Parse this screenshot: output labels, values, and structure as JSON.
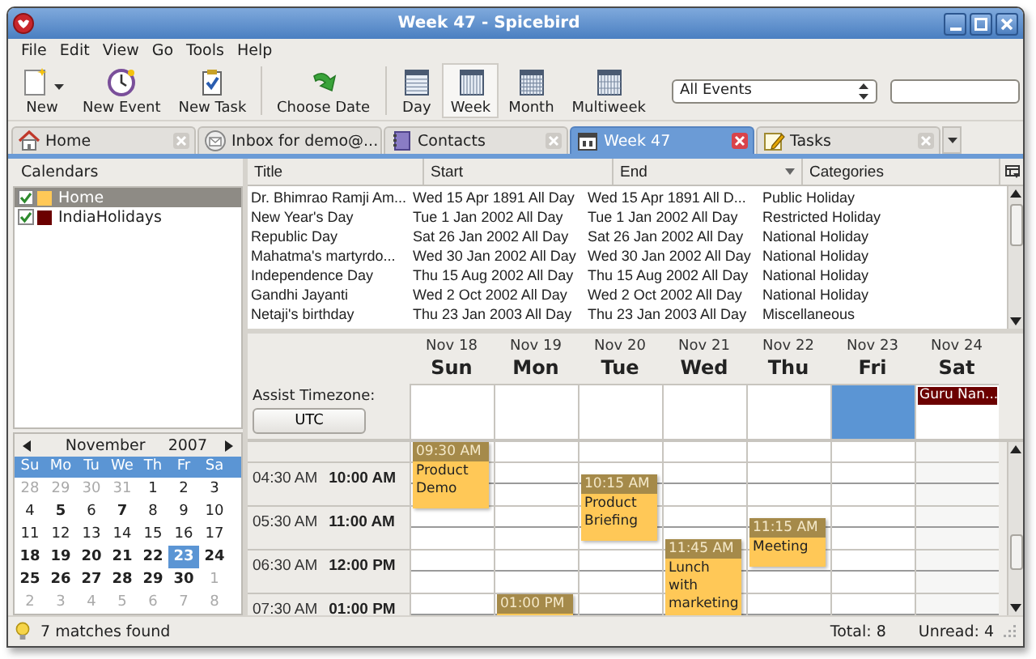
{
  "window": {
    "title": "Week 47 - Spicebird"
  },
  "menu": [
    "File",
    "Edit",
    "View",
    "Go",
    "Tools",
    "Help"
  ],
  "toolbar": {
    "groups": [
      [
        {
          "kind": "new",
          "label": "New",
          "dropdown": true,
          "selected": false
        },
        {
          "kind": "event",
          "label": "New Event",
          "dropdown": false,
          "selected": false
        },
        {
          "kind": "task",
          "label": "New Task",
          "dropdown": false,
          "selected": false
        }
      ],
      [
        {
          "kind": "goto",
          "label": "Choose Date",
          "dropdown": false,
          "selected": false
        }
      ],
      [
        {
          "kind": "day",
          "label": "Day",
          "dropdown": false,
          "selected": false
        },
        {
          "kind": "week",
          "label": "Week",
          "dropdown": false,
          "selected": true
        },
        {
          "kind": "month",
          "label": "Month",
          "dropdown": false,
          "selected": false
        },
        {
          "kind": "multiweek",
          "label": "Multiweek",
          "dropdown": false,
          "selected": false
        }
      ]
    ],
    "filter": "All Events"
  },
  "tabs": [
    {
      "kind": "home",
      "label": "Home",
      "selected": false
    },
    {
      "kind": "mail",
      "label": "Inbox for demo@...",
      "selected": false
    },
    {
      "kind": "contacts",
      "label": "Contacts",
      "selected": false
    },
    {
      "kind": "calendar",
      "label": "Week 47",
      "selected": true
    },
    {
      "kind": "tasks",
      "label": "Tasks",
      "selected": false
    }
  ],
  "calendars": {
    "title": "Calendars",
    "items": [
      {
        "name": "Home",
        "checked": true,
        "color": "#ffc857",
        "selected": true
      },
      {
        "name": "IndiaHolidays",
        "checked": true,
        "color": "#6b0000",
        "selected": false
      }
    ]
  },
  "mini_calendar": {
    "month": "November",
    "year": "2007",
    "weekdays": [
      "Su",
      "Mo",
      "Tu",
      "We",
      "Th",
      "Fr",
      "Sa"
    ],
    "weeks": [
      [
        {
          "day": "28",
          "other_month": true,
          "bold": false,
          "selected": false
        },
        {
          "day": "29",
          "other_month": true,
          "bold": false,
          "selected": false
        },
        {
          "day": "30",
          "other_month": true,
          "bold": false,
          "selected": false
        },
        {
          "day": "31",
          "other_month": true,
          "bold": false,
          "selected": false
        },
        {
          "day": "1",
          "other_month": false,
          "bold": false,
          "selected": false
        },
        {
          "day": "2",
          "other_month": false,
          "bold": false,
          "selected": false
        },
        {
          "day": "3",
          "other_month": false,
          "bold": false,
          "selected": false
        }
      ],
      [
        {
          "day": "4",
          "other_month": false,
          "bold": false,
          "selected": false
        },
        {
          "day": "5",
          "other_month": false,
          "bold": true,
          "selected": false
        },
        {
          "day": "6",
          "other_month": false,
          "bold": false,
          "selected": false
        },
        {
          "day": "7",
          "other_month": false,
          "bold": true,
          "selected": false
        },
        {
          "day": "8",
          "other_month": false,
          "bold": false,
          "selected": false
        },
        {
          "day": "9",
          "other_month": false,
          "bold": false,
          "selected": false
        },
        {
          "day": "10",
          "other_month": false,
          "bold": false,
          "selected": false
        }
      ],
      [
        {
          "day": "11",
          "other_month": false,
          "bold": false,
          "selected": false
        },
        {
          "day": "12",
          "other_month": false,
          "bold": false,
          "selected": false
        },
        {
          "day": "13",
          "other_month": false,
          "bold": false,
          "selected": false
        },
        {
          "day": "14",
          "other_month": false,
          "bold": false,
          "selected": false
        },
        {
          "day": "15",
          "other_month": false,
          "bold": false,
          "selected": false
        },
        {
          "day": "16",
          "other_month": false,
          "bold": false,
          "selected": false
        },
        {
          "day": "17",
          "other_month": false,
          "bold": false,
          "selected": false
        }
      ],
      [
        {
          "day": "18",
          "other_month": false,
          "bold": true,
          "selected": false
        },
        {
          "day": "19",
          "other_month": false,
          "bold": true,
          "selected": false
        },
        {
          "day": "20",
          "other_month": false,
          "bold": true,
          "selected": false
        },
        {
          "day": "21",
          "other_month": false,
          "bold": true,
          "selected": false
        },
        {
          "day": "22",
          "other_month": false,
          "bold": true,
          "selected": false
        },
        {
          "day": "23",
          "other_month": false,
          "bold": true,
          "selected": true
        },
        {
          "day": "24",
          "other_month": false,
          "bold": true,
          "selected": false
        }
      ],
      [
        {
          "day": "25",
          "other_month": false,
          "bold": true,
          "selected": false
        },
        {
          "day": "26",
          "other_month": false,
          "bold": true,
          "selected": false
        },
        {
          "day": "27",
          "other_month": false,
          "bold": true,
          "selected": false
        },
        {
          "day": "28",
          "other_month": false,
          "bold": true,
          "selected": false
        },
        {
          "day": "29",
          "other_month": false,
          "bold": true,
          "selected": false
        },
        {
          "day": "30",
          "other_month": false,
          "bold": true,
          "selected": false
        },
        {
          "day": "1",
          "other_month": true,
          "bold": false,
          "selected": false
        }
      ],
      [
        {
          "day": "2",
          "other_month": true,
          "bold": false,
          "selected": false
        },
        {
          "day": "3",
          "other_month": true,
          "bold": false,
          "selected": false
        },
        {
          "day": "4",
          "other_month": true,
          "bold": false,
          "selected": false
        },
        {
          "day": "5",
          "other_month": true,
          "bold": false,
          "selected": false
        },
        {
          "day": "6",
          "other_month": true,
          "bold": false,
          "selected": false
        },
        {
          "day": "7",
          "other_month": true,
          "bold": false,
          "selected": false
        },
        {
          "day": "8",
          "other_month": true,
          "bold": false,
          "selected": false
        }
      ]
    ]
  },
  "event_list": {
    "columns": [
      {
        "label": "Title",
        "sorted": false
      },
      {
        "label": "Start",
        "sorted": false
      },
      {
        "label": "End",
        "sorted": true
      },
      {
        "label": "Categories",
        "sorted": false
      }
    ],
    "rows": [
      [
        "Dr. Bhimrao Ramji Am...",
        "Wed 15 Apr 1891 All Day",
        "Wed 15 Apr 1891 All D...",
        "Public Holiday"
      ],
      [
        "New Year's Day",
        "Tue 1 Jan 2002 All Day",
        "Tue 1 Jan 2002 All Day",
        "Restricted Holiday"
      ],
      [
        "Republic Day",
        "Sat 26 Jan 2002 All Day",
        "Sat 26 Jan 2002 All Day",
        "National Holiday"
      ],
      [
        "Mahatma's martyrdo...",
        "Wed 30 Jan 2002 All Day",
        "Wed 30 Jan 2002 All Day",
        "National Holiday"
      ],
      [
        "Independence Day",
        "Thu 15 Aug 2002 All Day",
        "Thu 15 Aug 2002 All Day",
        "National Holiday"
      ],
      [
        "Gandhi Jayanti",
        "Wed 2 Oct 2002 All Day",
        "Wed 2 Oct 2002 All Day",
        "National Holiday"
      ],
      [
        "Netaji's birthday",
        "Thu 23 Jan 2003 All Day",
        "Thu 23 Jan 2003 All Day",
        "Miscellaneous"
      ]
    ]
  },
  "week_view": {
    "assist_label": "Assist Timezone:",
    "timezone": "UTC",
    "hours": [
      {
        "local": "04:30 AM",
        "zone": "10:00 AM"
      },
      {
        "local": "05:30 AM",
        "zone": "11:00 AM"
      },
      {
        "local": "06:30 AM",
        "zone": "12:00 PM"
      },
      {
        "local": "07:30 AM",
        "zone": "01:00 PM"
      }
    ],
    "days": [
      {
        "date": "Nov 18",
        "name": "Sun",
        "today": false,
        "events": [
          {
            "time": "09:30 AM",
            "title": "Product Demo",
            "color": "#ffc857"
          }
        ]
      },
      {
        "date": "Nov 19",
        "name": "Mon",
        "today": false,
        "events": [
          {
            "time": "01:00 PM",
            "color": "#ffc857"
          }
        ]
      },
      {
        "date": "Nov 20",
        "name": "Tue",
        "today": false,
        "events": [
          {
            "time": "10:15 AM",
            "title": "Product Briefing",
            "color": "#ffc857"
          }
        ]
      },
      {
        "date": "Nov 21",
        "name": "Wed",
        "today": false,
        "events": [
          {
            "time": "11:45 AM",
            "title": "Lunch with marketing",
            "color": "#ffc857"
          }
        ]
      },
      {
        "date": "Nov 22",
        "name": "Thu",
        "today": false,
        "events": [
          {
            "time": "11:15 AM",
            "title": "Meeting",
            "color": "#ffc857"
          }
        ]
      },
      {
        "date": "Nov 23",
        "name": "Fri",
        "today": true
      },
      {
        "date": "Nov 24",
        "name": "Sat",
        "today": false,
        "all_day": [
          {
            "title": "Guru Nan...",
            "color": "#6b0000"
          }
        ]
      }
    ]
  },
  "status_bar": {
    "message": "7 matches found",
    "total": "Total: 8",
    "unread": "Unread: 4"
  }
}
